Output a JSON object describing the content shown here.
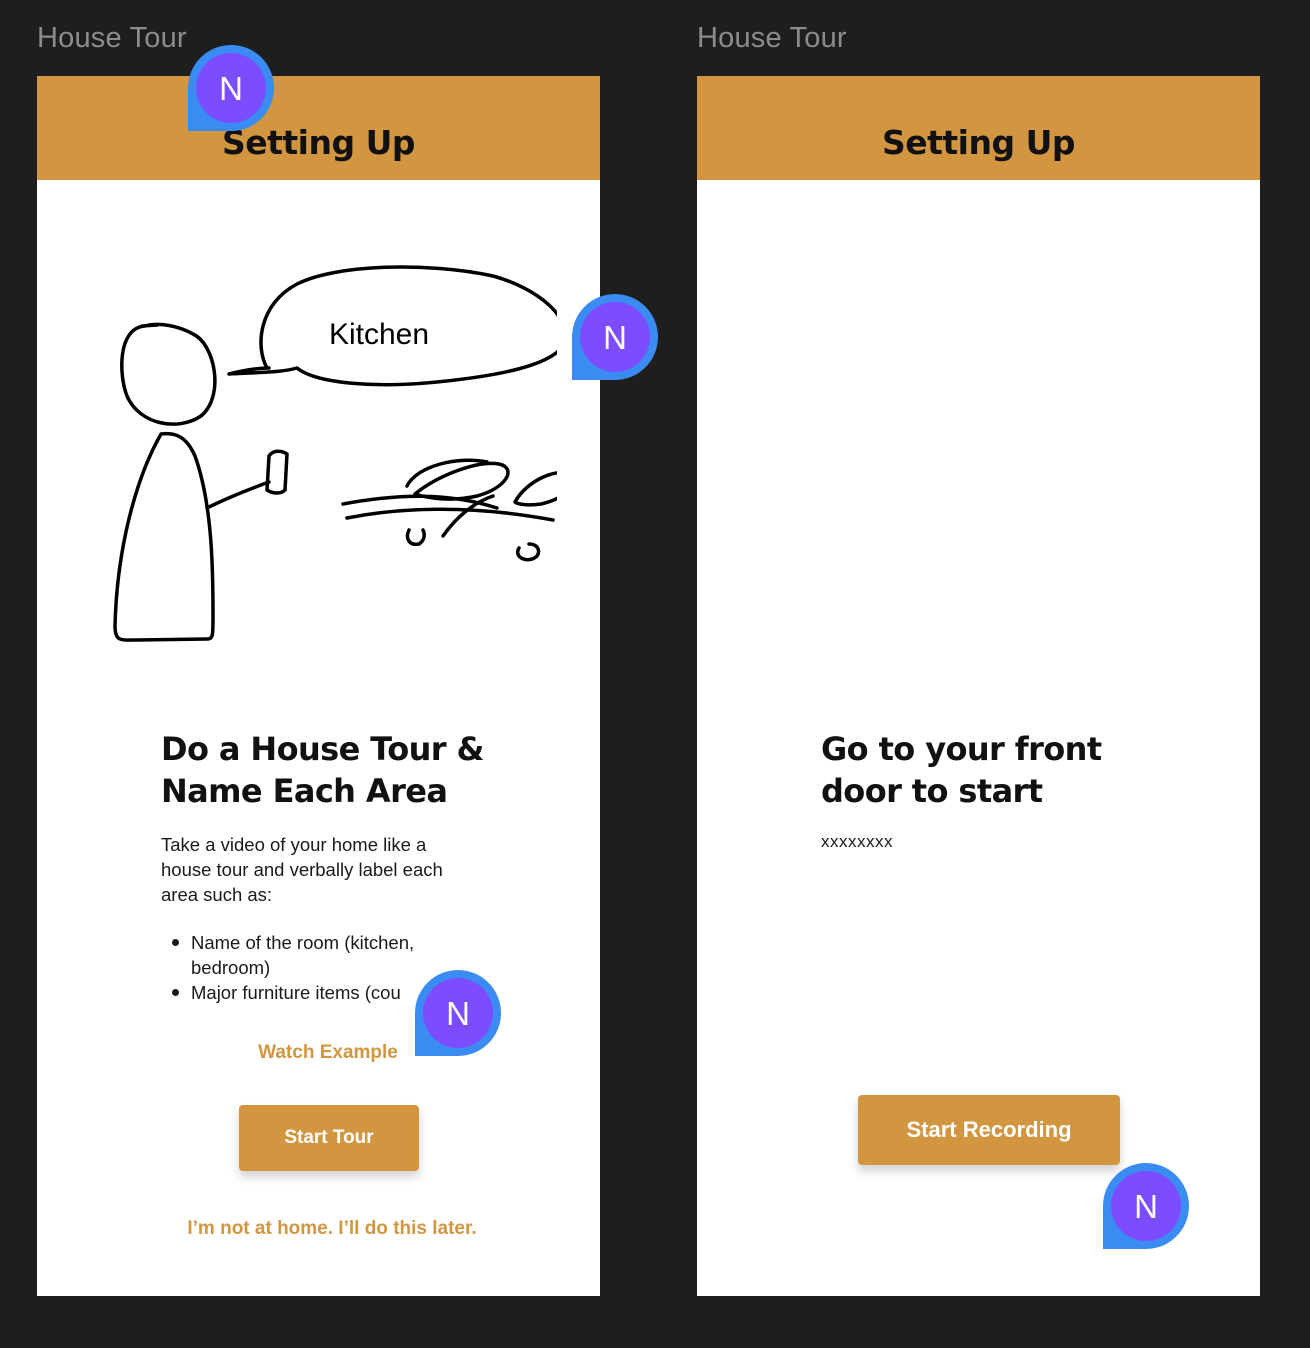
{
  "frames": [
    {
      "title": "House Tour",
      "header_title": "Setting Up",
      "illustration": {
        "speech_text": "Kitchen"
      },
      "headline": "Do a House Tour & Name Each Area",
      "body": "Take a video of your home like a house tour and verbally label each area such as:",
      "bullets": [
        "Name of the room (kitchen, bedroom)",
        "Major furniture items (cou"
      ],
      "watch_example": "Watch Example",
      "start_button": "Start Tour",
      "later_link": "I’m not at home. I’ll do this later."
    },
    {
      "title": "House Tour",
      "header_title": "Setting Up",
      "headline": "Go to your front door to start",
      "body": "xxxxxxxx",
      "start_button": "Start Recording"
    }
  ],
  "collaborator": {
    "initial": "N",
    "color": "#7c4dff",
    "pin_color": "#3b8cf2"
  },
  "colors": {
    "accent": "#d39640",
    "canvas": "#1e1e1e",
    "frame": "#ffffff"
  }
}
